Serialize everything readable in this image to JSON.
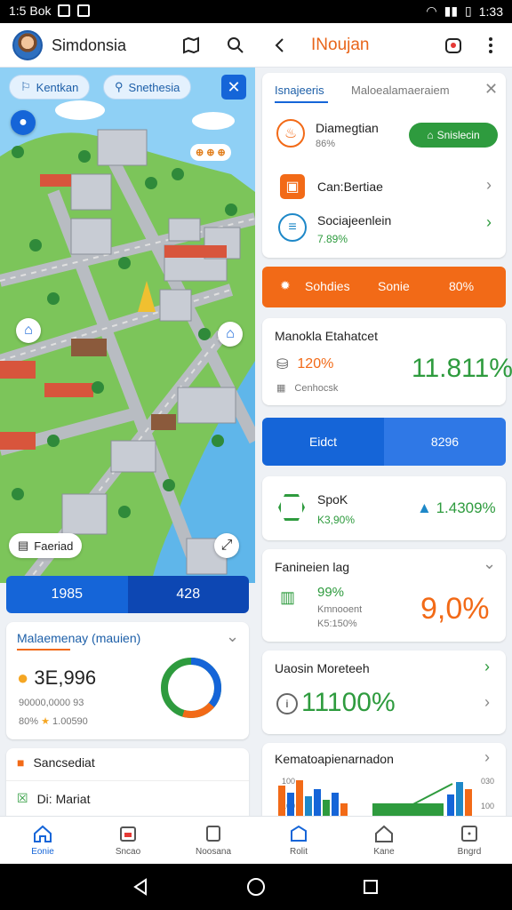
{
  "status": {
    "time_left": "1:5 Bok",
    "time_right": "1:33"
  },
  "appbar": {
    "title": "Simdonsia",
    "right_title": "INoujan"
  },
  "map": {
    "chips": [
      "Kentkan",
      "Snethesia"
    ],
    "tag": "⊕ ⊕ ⊕",
    "badge_label": "Faeriad"
  },
  "stats_bar": {
    "left": "1985",
    "right": "428"
  },
  "left_card1": {
    "title": "Malaemenay (mauien)",
    "value": "3E,996",
    "sub1": "90000,0000 93",
    "sub2": "80%",
    "sub2b": "1.00590"
  },
  "left_card2": {
    "item1": "Sancsediat",
    "item2": "Di: Mariat"
  },
  "right": {
    "tabs": [
      "Isnajeeris",
      "Maloealamaeraiem"
    ],
    "list": [
      {
        "title": "Diamegtian",
        "sub": "86%",
        "action": "Snislecin"
      },
      {
        "title": "Can:Bertiae"
      },
      {
        "title": "Sociajeenlein",
        "sub": "7.89%"
      }
    ],
    "orange_bar": {
      "a": "Sohdies",
      "b": "Sonie",
      "c": "80%"
    },
    "card_mano": {
      "title": "Manokla Etahatcet",
      "pct": "120%",
      "sub": "Cenhocsk",
      "big": "11.811%"
    },
    "blue_bar": {
      "left": "Eidct",
      "right": "8296"
    },
    "card_sp": {
      "title": "SpoK",
      "sub": "K3,90%",
      "big": "1.4309%"
    },
    "card_fa": {
      "title": "Fanineien lag",
      "pct": "99%",
      "sub1": "Kmnooent",
      "sub2": "K5:150%",
      "big": "9,0%"
    },
    "card_ua": {
      "title": "Uaosin Moreteeh",
      "big": "11100%"
    },
    "card_chart": {
      "title": "Kematoapienarnadon",
      "l1": "100",
      "l2": "100",
      "r1": "030",
      "r2": "100"
    }
  },
  "nav": [
    "Eonie",
    "Sncao",
    "Noosana",
    "Rolit",
    "Kane",
    "Bngrd"
  ],
  "colors": {
    "accent": "#1565d8",
    "orange": "#f26a17",
    "green": "#2e9b3e"
  }
}
